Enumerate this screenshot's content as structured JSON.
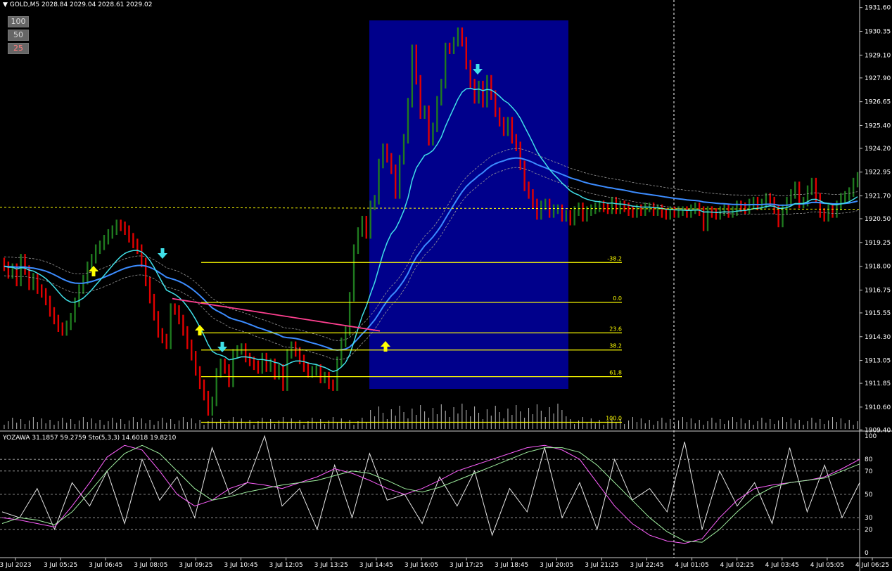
{
  "header": {
    "symbol_text": "GOLD,M5",
    "ohlc_text": "2028.84 2029.04 2028.61 2029.02"
  },
  "zoom_buttons": [
    "100",
    "50",
    "25"
  ],
  "indicator_header": "YOZAWA 31.1857 59.2759  Sto(5,3,3) 14.6018 19.8210",
  "colors": {
    "background": "#000000",
    "chart_box": "#00008B",
    "bull_bar": "#1f7a1f",
    "bear_bar": "#e00000",
    "fib_line": "#ffff00",
    "ma_fast": "#40e0e8",
    "ma_slow": "#3c8cff",
    "ma_pink": "#ff4090",
    "arrow_up": "#ffff00",
    "arrow_down": "#40e0e8",
    "osc_white": "#e6e6e6",
    "osc_pink": "#ff60ff",
    "osc_green": "#a0f0a0"
  },
  "chart_data": [
    {
      "type": "candlestick",
      "ylim": [
        1909.45,
        1931.7
      ],
      "y_ticks": [
        "1931.60",
        "1930.35",
        "1929.10",
        "1927.90",
        "1926.65",
        "1925.40",
        "1924.20",
        "1922.95",
        "1921.70",
        "1920.50",
        "1919.25",
        "1918.00",
        "1916.75",
        "1915.55",
        "1914.30",
        "1913.05",
        "1911.85",
        "1910.60",
        "1909.40"
      ],
      "x_ticks": [
        "3 Jul 2023",
        "3 Jul 05:25",
        "3 Jul 06:45",
        "3 Jul 08:05",
        "3 Jul 09:25",
        "3 Jul 10:45",
        "3 Jul 12:05",
        "3 Jul 13:25",
        "3 Jul 14:45",
        "3 Jul 16:05",
        "3 Jul 17:25",
        "3 Jul 18:45",
        "3 Jul 20:05",
        "3 Jul 21:25",
        "3 Jul 22:45",
        "4 Jul 01:05",
        "4 Jul 02:25",
        "4 Jul 03:45",
        "4 Jul 05:05",
        "4 Jul 06:25"
      ],
      "fibonacci_levels": [
        {
          "label": "-38.2",
          "price": 1918.2
        },
        {
          "label": "0.0",
          "price": 1916.1
        },
        {
          "label": "23.6",
          "price": 1914.5
        },
        {
          "label": "38.2",
          "price": 1913.6
        },
        {
          "label": "61.8",
          "price": 1912.2
        },
        {
          "label": "100.0",
          "price": 1909.8
        }
      ],
      "closes": [
        1918.0,
        1917.6,
        1917.9,
        1917.2,
        1918.4,
        1917.8,
        1917.0,
        1917.4,
        1916.8,
        1916.6,
        1916.2,
        1915.6,
        1915.2,
        1914.8,
        1914.6,
        1914.9,
        1915.3,
        1916.1,
        1916.8,
        1917.3,
        1918.0,
        1918.4,
        1918.9,
        1919.1,
        1919.4,
        1919.7,
        1919.9,
        1920.2,
        1920.1,
        1919.9,
        1919.5,
        1919.2,
        1918.9,
        1918.2,
        1917.2,
        1916.3,
        1915.4,
        1914.5,
        1914.2,
        1913.9,
        1915.8,
        1915.7,
        1915.2,
        1914.6,
        1913.9,
        1913.3,
        1912.5,
        1911.8,
        1911.2,
        1910.4,
        1910.9,
        1912.4,
        1912.9,
        1912.6,
        1911.9,
        1913.4,
        1913.6,
        1913.7,
        1913.2,
        1913.0,
        1912.8,
        1912.6,
        1913.2,
        1912.7,
        1912.9,
        1912.3,
        1912.6,
        1911.7,
        1913.4,
        1913.8,
        1913.5,
        1913.1,
        1912.7,
        1912.4,
        1912.5,
        1912.6,
        1912.1,
        1912.2,
        1911.8,
        1911.7,
        1913.0,
        1914.0,
        1914.6,
        1916.4,
        1918.9,
        1919.8,
        1920.4,
        1919.7,
        1921.2,
        1921.5,
        1923.4,
        1924.2,
        1923.7,
        1923.1,
        1921.8,
        1923.6,
        1924.7,
        1926.6,
        1929.4,
        1927.8,
        1926.0,
        1926.2,
        1924.6,
        1925.3,
        1926.7,
        1927.6,
        1929.5,
        1929.4,
        1929.8,
        1930.3,
        1929.8,
        1928.6,
        1927.6,
        1926.8,
        1927.5,
        1926.6,
        1927.8,
        1927.0,
        1926.1,
        1925.6,
        1925.1,
        1925.6,
        1924.7,
        1924.3,
        1923.3,
        1922.2,
        1921.8,
        1921.3,
        1920.7,
        1921.2,
        1921.3,
        1920.8,
        1921.0,
        1921.0,
        1920.6,
        1920.7,
        1920.4,
        1920.9,
        1921.1,
        1920.6,
        1920.9,
        1921.0,
        1921.1,
        1921.2,
        1921.1,
        1921.0,
        1921.4,
        1921.0,
        1921.2,
        1921.1,
        1920.9,
        1920.8,
        1921.0,
        1920.9,
        1921.1,
        1921.1,
        1920.9,
        1921.0,
        1920.8,
        1920.7,
        1920.9,
        1920.8,
        1920.9,
        1920.9,
        1920.8,
        1921.0,
        1921.1,
        1920.9,
        1920.1,
        1920.9,
        1920.8,
        1920.7,
        1920.9,
        1921.0,
        1920.8,
        1920.9,
        1921.2,
        1921.1,
        1921.0,
        1921.3,
        1921.4,
        1921.2,
        1921.3,
        1921.6,
        1921.4,
        1921.0,
        1920.3,
        1921.0,
        1921.4,
        1921.8,
        1922.2,
        1921.3,
        1921.4,
        1922.0,
        1922.4,
        1921.6,
        1920.8,
        1920.6,
        1921.0,
        1920.8,
        1921.2,
        1921.6,
        1921.7,
        1921.9,
        1922.4,
        1922.7
      ]
    },
    {
      "type": "line",
      "title": "YOZAWA 31.1857 59.2759  Sto(5,3,3) 14.6018 19.8210",
      "ylim": [
        0,
        100
      ],
      "y_ticks": [
        "100",
        "80",
        "70",
        "50",
        "30",
        "20",
        "0"
      ],
      "series": [
        {
          "values": [
            35,
            30,
            55,
            20,
            60,
            40,
            70,
            25,
            80,
            45,
            65,
            30,
            90,
            50,
            60,
            100,
            40,
            55,
            20,
            75,
            30,
            85,
            45,
            50,
            25,
            65,
            40,
            70,
            15,
            55,
            35,
            90,
            30,
            60,
            20,
            80,
            45,
            55,
            35,
            95,
            20,
            70,
            40,
            60,
            25,
            90,
            35,
            75,
            30,
            60
          ]
        },
        {
          "values": [
            30,
            28,
            25,
            22,
            40,
            60,
            82,
            92,
            88,
            70,
            50,
            40,
            45,
            55,
            60,
            58,
            55,
            60,
            65,
            72,
            68,
            62,
            55,
            50,
            55,
            62,
            70,
            75,
            80,
            85,
            90,
            92,
            88,
            80,
            60,
            40,
            25,
            15,
            10,
            8,
            12,
            30,
            45,
            55,
            58,
            60,
            62,
            65,
            72,
            80
          ]
        },
        {
          "values": [
            25,
            30,
            28,
            24,
            35,
            52,
            70,
            85,
            92,
            85,
            70,
            55,
            45,
            48,
            52,
            55,
            58,
            60,
            62,
            66,
            70,
            68,
            62,
            55,
            52,
            56,
            62,
            68,
            74,
            80,
            86,
            90,
            90,
            86,
            75,
            60,
            45,
            30,
            18,
            10,
            9,
            20,
            35,
            48,
            56,
            60,
            62,
            64,
            70,
            76
          ]
        }
      ]
    }
  ]
}
